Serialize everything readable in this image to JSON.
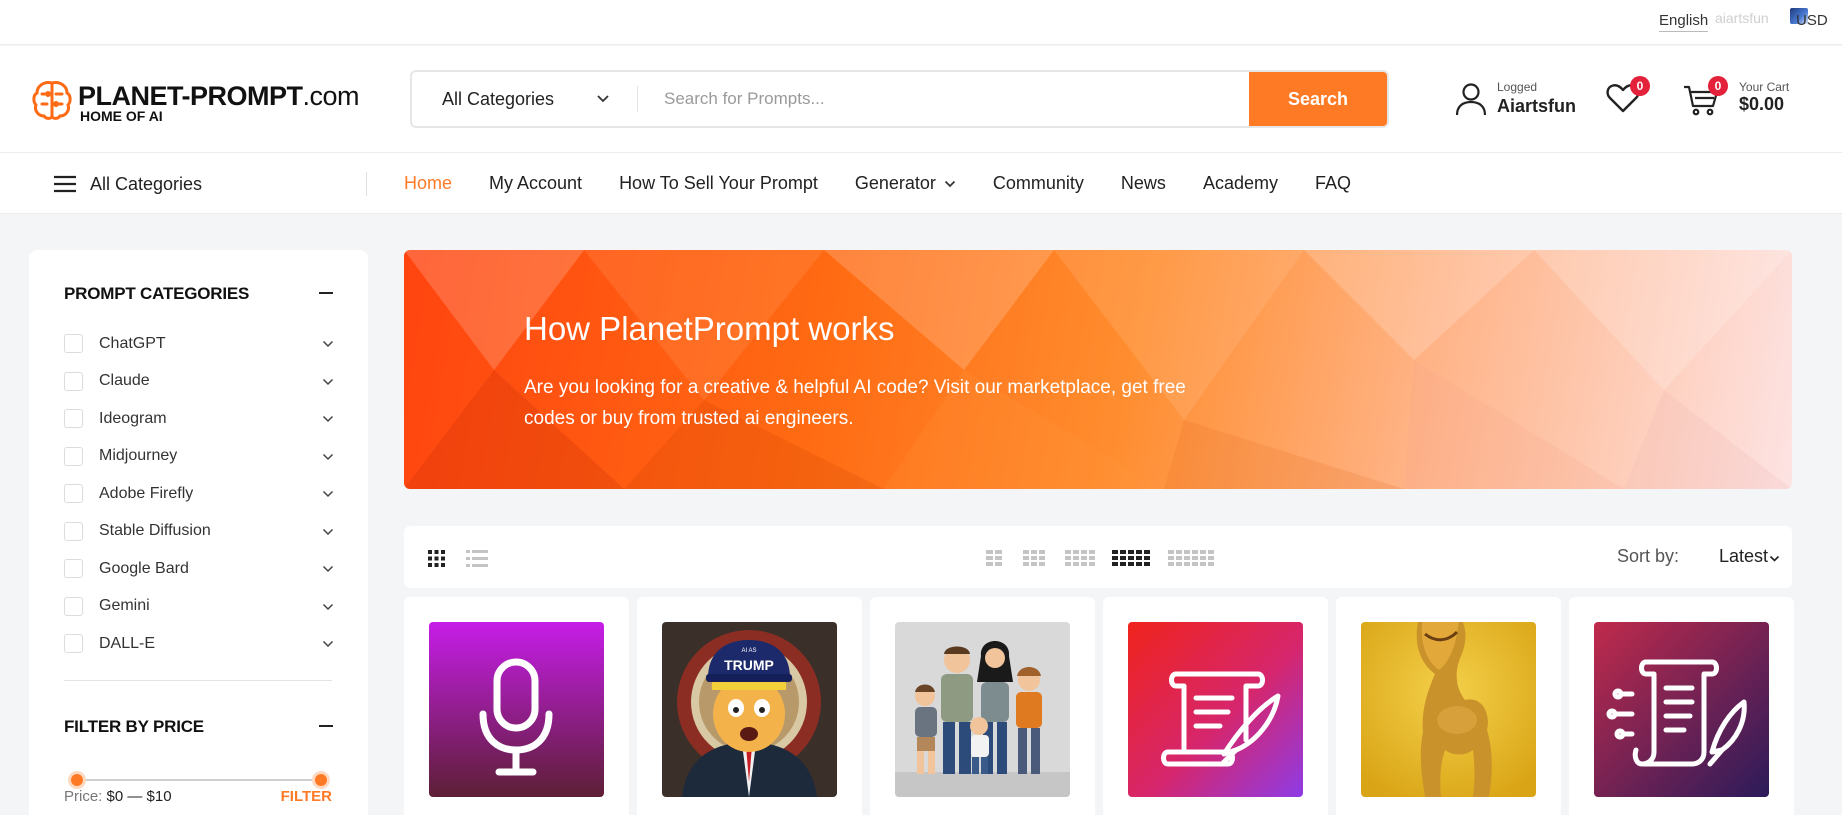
{
  "topbar": {
    "language": "English",
    "user_ghost": "aiartsfun",
    "currency": "USD"
  },
  "logo": {
    "name": "PLANET-PROMPT",
    "domain": ".com",
    "tagline": "HOME OF AI"
  },
  "search": {
    "category": "All Categories",
    "placeholder": "Search for Prompts...",
    "button": "Search"
  },
  "account": {
    "status": "Logged",
    "username": "Aiartsfun"
  },
  "wishlist": {
    "count": "0"
  },
  "cart": {
    "count": "0",
    "label": "Your Cart",
    "total": "$0.00"
  },
  "nav": {
    "all_categories": "All Categories",
    "links": [
      "Home",
      "My Account",
      "How To Sell Your Prompt",
      "Generator",
      "Community",
      "News",
      "Academy",
      "FAQ"
    ]
  },
  "sidebar": {
    "categories_title": "PROMPT CATEGORIES",
    "categories": [
      "ChatGPT",
      "Claude",
      "Ideogram",
      "Midjourney",
      "Adobe Firefly",
      "Stable Diffusion",
      "Google Bard",
      "Gemini",
      "DALL-E"
    ],
    "price_title": "FILTER BY PRICE",
    "price_label": "Price:",
    "price_range": "$0 — $10",
    "filter_button": "FILTER",
    "price_min": 0,
    "price_max": 10
  },
  "banner": {
    "title": "How PlanetPrompt works",
    "text": "Are you looking for a creative & helpful AI code? Visit our marketplace, get free codes or buy from trusted ai engineers."
  },
  "toolbar": {
    "sort_label": "Sort by:",
    "sort_value": "Latest",
    "active_columns": "6"
  },
  "products": [
    {
      "thumb": "microphone-icon",
      "colors": [
        "#c61de8",
        "#5d1f35"
      ]
    },
    {
      "thumb": "trump-cartoon",
      "caps_text": "TRUMP",
      "caps_small": "AI AS"
    },
    {
      "thumb": "family-cartoon"
    },
    {
      "thumb": "scroll-quill-icon",
      "colors": [
        "#f0241c",
        "#8e3be6"
      ]
    },
    {
      "thumb": "yellow-camel",
      "colors": [
        "#e8b41c"
      ]
    },
    {
      "thumb": "ai-document-icon",
      "colors": [
        "#c02a4c",
        "#2b1b5a"
      ]
    }
  ],
  "colors": {
    "accent": "#ff7a25",
    "badge": "#e4213a"
  }
}
